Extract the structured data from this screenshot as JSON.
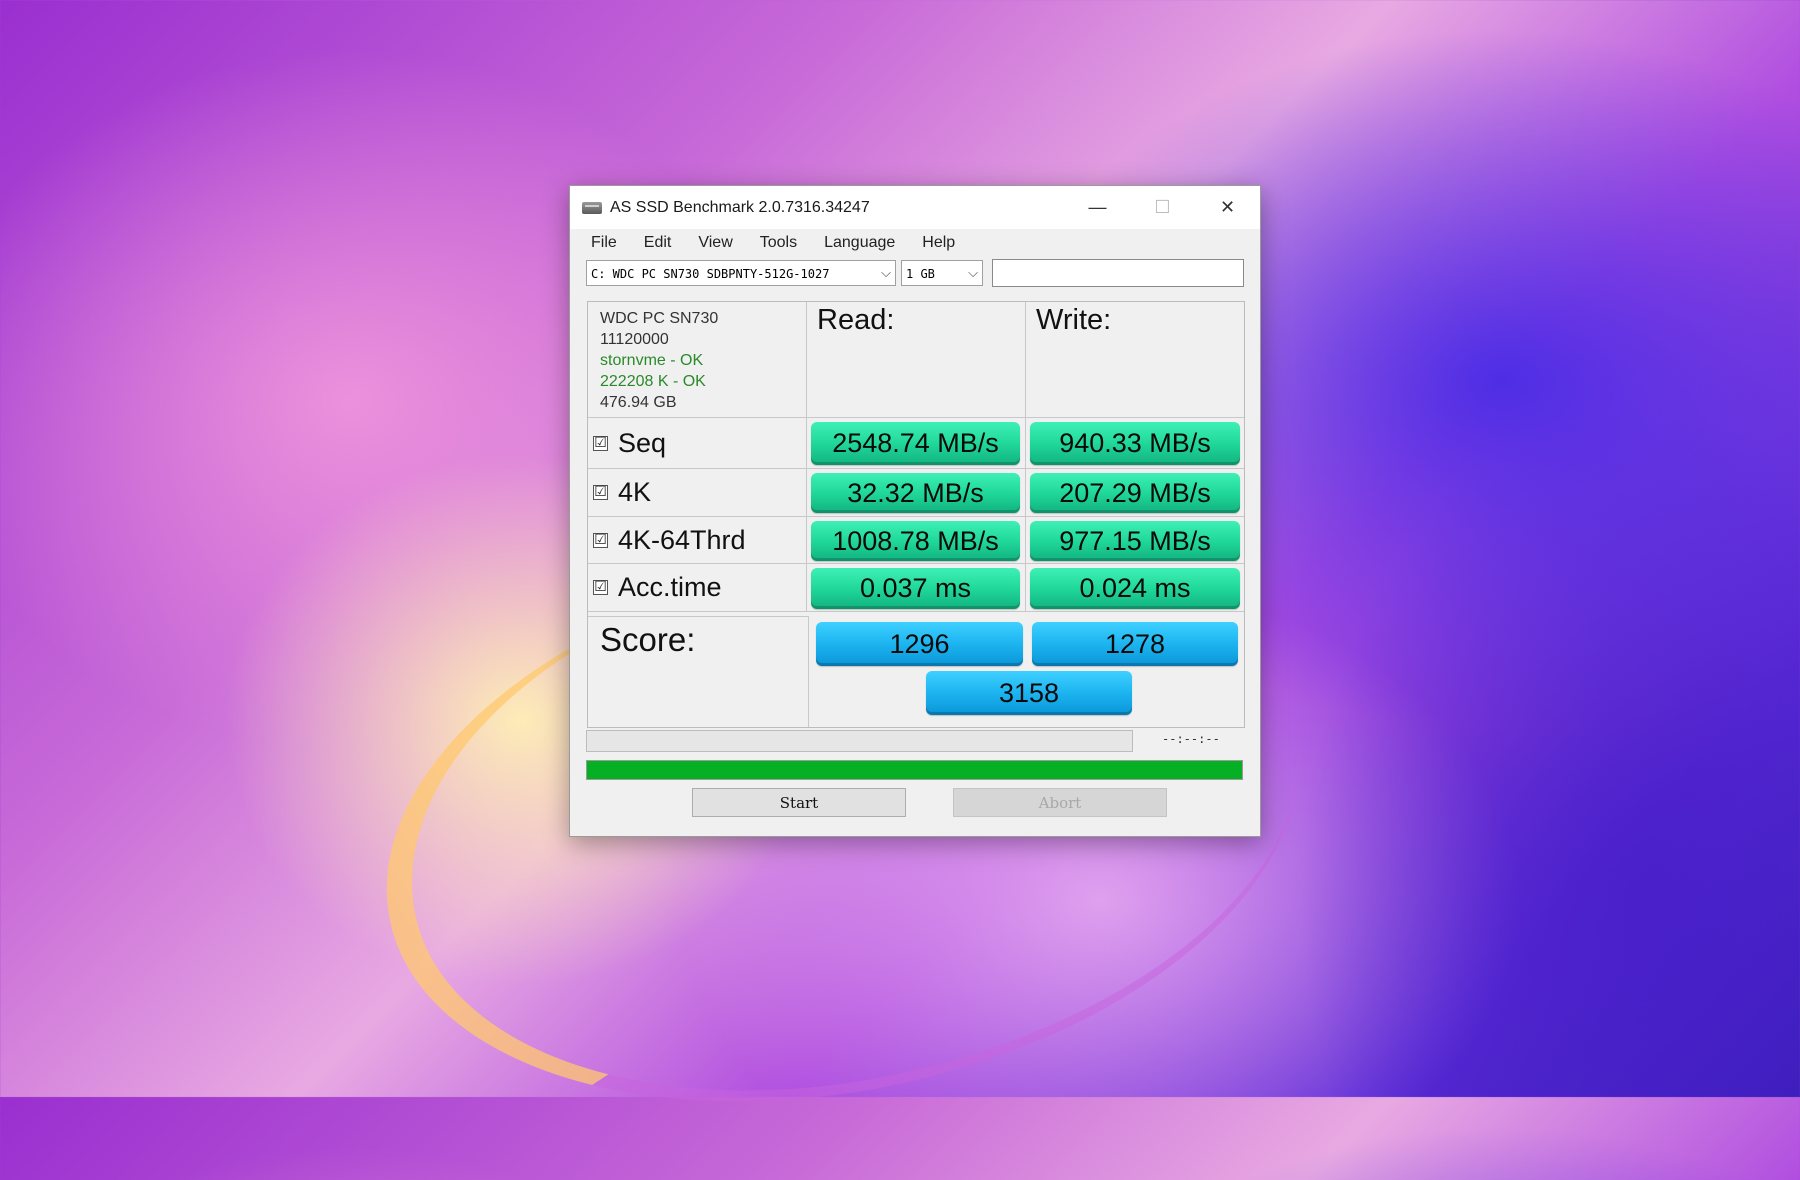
{
  "window": {
    "title": "AS SSD Benchmark 2.0.7316.34247",
    "minimize": "—",
    "maximize": "☐",
    "close": "✕"
  },
  "menu": [
    "File",
    "Edit",
    "View",
    "Tools",
    "Language",
    "Help"
  ],
  "toolbar": {
    "drive_select": "C: WDC PC SN730 SDBPNTY-512G-1027",
    "size_select": "1 GB",
    "text_field": ""
  },
  "drive_info": {
    "model": "WDC PC SN730",
    "firmware": "11120000",
    "driver": "stornvme - OK",
    "alignment": "222208 K - OK",
    "capacity": "476.94 GB"
  },
  "headers": {
    "read": "Read:",
    "write": "Write:",
    "score": "Score:"
  },
  "rows": [
    {
      "label": "Seq",
      "checked": "☑",
      "read": "2548.74 MB/s",
      "write": "940.33 MB/s"
    },
    {
      "label": "4K",
      "checked": "☑",
      "read": "32.32 MB/s",
      "write": "207.29 MB/s"
    },
    {
      "label": "4K-64Thrd",
      "checked": "☑",
      "read": "1008.78 MB/s",
      "write": "977.15 MB/s"
    },
    {
      "label": "Acc.time",
      "checked": "☑",
      "read": "0.037 ms",
      "write": "0.024 ms"
    }
  ],
  "score": {
    "read": "1296",
    "write": "1278",
    "total": "3158"
  },
  "progress": {
    "time": "--:--:--",
    "fraction": 1.0
  },
  "buttons": {
    "start": "Start",
    "abort": "Abort"
  },
  "colors": {
    "value_box": "#20d89a",
    "score_box": "#1cb4f0",
    "progress": "#06b025"
  }
}
